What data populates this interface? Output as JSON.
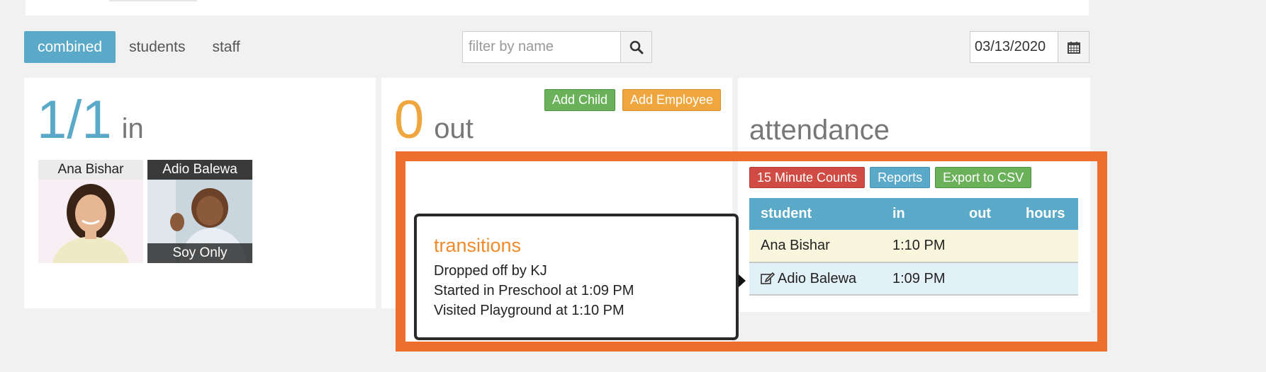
{
  "nav": {
    "tabs": [
      {
        "label": "combined",
        "active": true
      },
      {
        "label": "students",
        "active": false
      },
      {
        "label": "staff",
        "active": false
      }
    ]
  },
  "filter": {
    "placeholder": "filter by name",
    "icon": "search-icon"
  },
  "date": {
    "value": "03/13/2020",
    "icon": "calendar-icon"
  },
  "in_panel": {
    "count": "1/1",
    "label": "in"
  },
  "people": [
    {
      "name": "Ana Bishar",
      "tag": ""
    },
    {
      "name": "Adio Balewa",
      "tag": "Soy Only"
    }
  ],
  "out_panel": {
    "count": "0",
    "label": "out",
    "add_child": "Add Child",
    "add_employee": "Add Employee"
  },
  "attendance": {
    "title": "attendance",
    "buttons": {
      "counts": "15 Minute Counts",
      "reports": "Reports",
      "export": "Export to CSV"
    },
    "headers": {
      "student": "student",
      "in": "in",
      "out": "out",
      "hours": "hours"
    },
    "rows": [
      {
        "student": "Ana Bishar",
        "in": "1:10 PM",
        "out": "",
        "hours": "",
        "edit_icon": false
      },
      {
        "student": "Adio Balewa",
        "in": "1:09 PM",
        "out": "",
        "hours": "",
        "edit_icon": true
      }
    ]
  },
  "popover": {
    "title": "transitions",
    "lines": [
      "Dropped off by KJ",
      "Started in Preschool at 1:09 PM",
      "Visited Playground at 1:10 PM"
    ]
  },
  "colors": {
    "accent_blue": "#5ba9c9",
    "accent_orange": "#f0a63e",
    "highlight_orange": "#ee6f2d",
    "green": "#6ab15a",
    "red": "#d04b43"
  }
}
